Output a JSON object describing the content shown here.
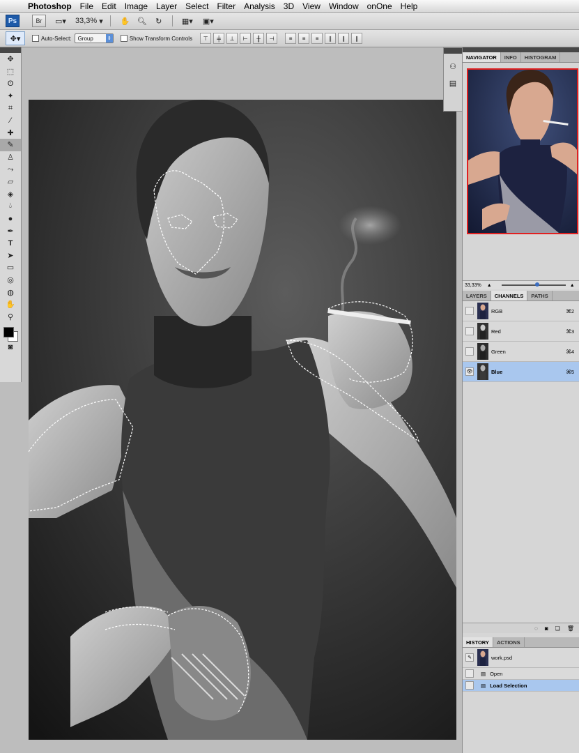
{
  "menubar": {
    "items": [
      "Photoshop",
      "File",
      "Edit",
      "Image",
      "Layer",
      "Select",
      "Filter",
      "Analysis",
      "3D",
      "View",
      "Window",
      "onOne",
      "Help"
    ]
  },
  "appbar": {
    "ps_logo": "Ps",
    "br_logo": "Br",
    "zoom": "33,3%"
  },
  "options": {
    "auto_select_label": "Auto-Select:",
    "auto_select_value": "Group",
    "transform_label": "Show Transform Controls"
  },
  "navigator": {
    "tabs": [
      "NAVIGATOR",
      "INFO",
      "HISTOGRAM"
    ],
    "zoom": "33,33%"
  },
  "channels": {
    "tabs": [
      "LAYERS",
      "CHANNELS",
      "PATHS"
    ],
    "rows": [
      {
        "name": "RGB",
        "key": "⌘2"
      },
      {
        "name": "Red",
        "key": "⌘3"
      },
      {
        "name": "Green",
        "key": "⌘4"
      },
      {
        "name": "Blue",
        "key": "⌘5"
      }
    ]
  },
  "history": {
    "tabs": [
      "HISTORY",
      "ACTIONS"
    ],
    "snapshot": "work.psd",
    "states": [
      "Open",
      "Load Selection"
    ]
  },
  "colors": {
    "accent": "#a9c7ee",
    "nav_frame": "#e02020"
  }
}
